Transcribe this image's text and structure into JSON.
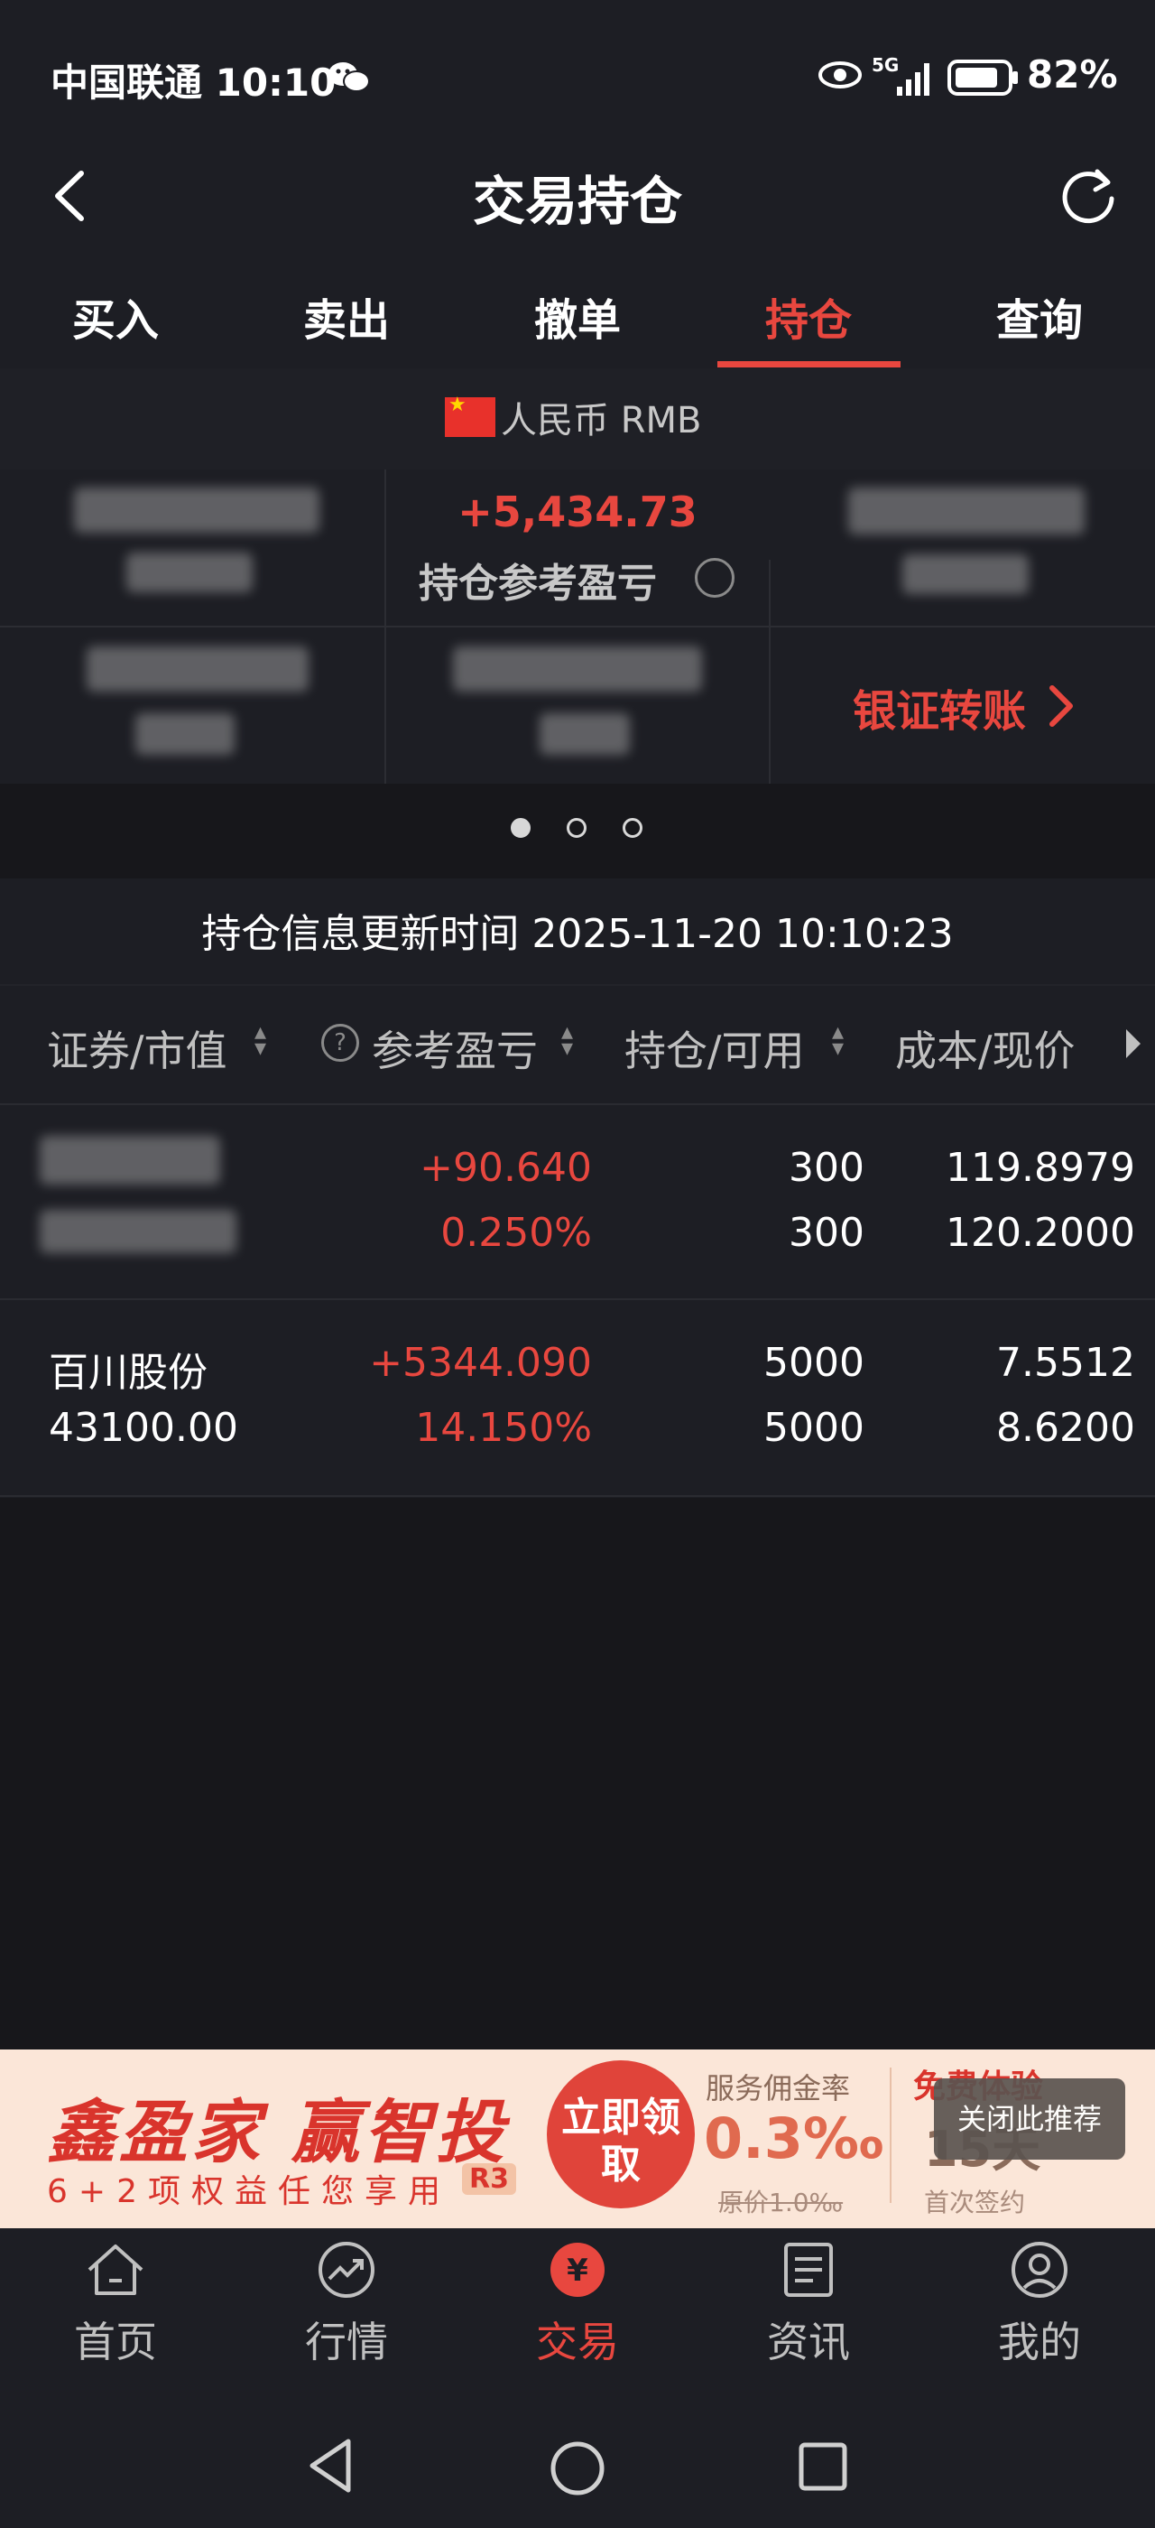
{
  "status_bar": {
    "carrier_time": "中国联通 10:10",
    "battery": "82%",
    "network": "5G"
  },
  "header": {
    "title": "交易持仓"
  },
  "tabs": [
    "买入",
    "卖出",
    "撤单",
    "持仓",
    "查询"
  ],
  "active_tab": "持仓",
  "currency": {
    "label": "人民币 RMB"
  },
  "summary": {
    "pnl_value": "+5,434.73",
    "pnl_label": "持仓参考盈亏",
    "transfer_label": "银证转账"
  },
  "update_time": "持仓信息更新时间 2025-11-20 10:10:23",
  "columns": [
    "证券/市值",
    "参考盈亏",
    "持仓/可用",
    "成本/现价"
  ],
  "rows": [
    {
      "name": "",
      "market_value": "",
      "pnl": "+90.640",
      "pnl_pct": "0.250%",
      "hold": "300",
      "avail": "300",
      "cost": "119.8979",
      "price": "120.2000"
    },
    {
      "name": "百川股份",
      "market_value": "43100.00",
      "pnl": "+5344.090",
      "pnl_pct": "14.150%",
      "hold": "5000",
      "avail": "5000",
      "cost": "7.5512",
      "price": "8.6200"
    }
  ],
  "ad": {
    "main": "鑫盈家 赢智投",
    "sub": "6+2项权益任您享用",
    "sub_badge": "R3",
    "circle": "立即领取",
    "rate_label": "服务佣金率",
    "rate": "0.3‰",
    "orig_rate": "原价1.0‰",
    "free_label": "免费体验",
    "days": "15天",
    "first_sign": "首次签约",
    "close": "关闭此推荐"
  },
  "nav": [
    "首页",
    "行情",
    "交易",
    "资讯",
    "我的"
  ],
  "active_nav": "交易",
  "colors": {
    "accent": "#e8473f",
    "bg": "#17171b",
    "panel": "#1d1e24"
  }
}
